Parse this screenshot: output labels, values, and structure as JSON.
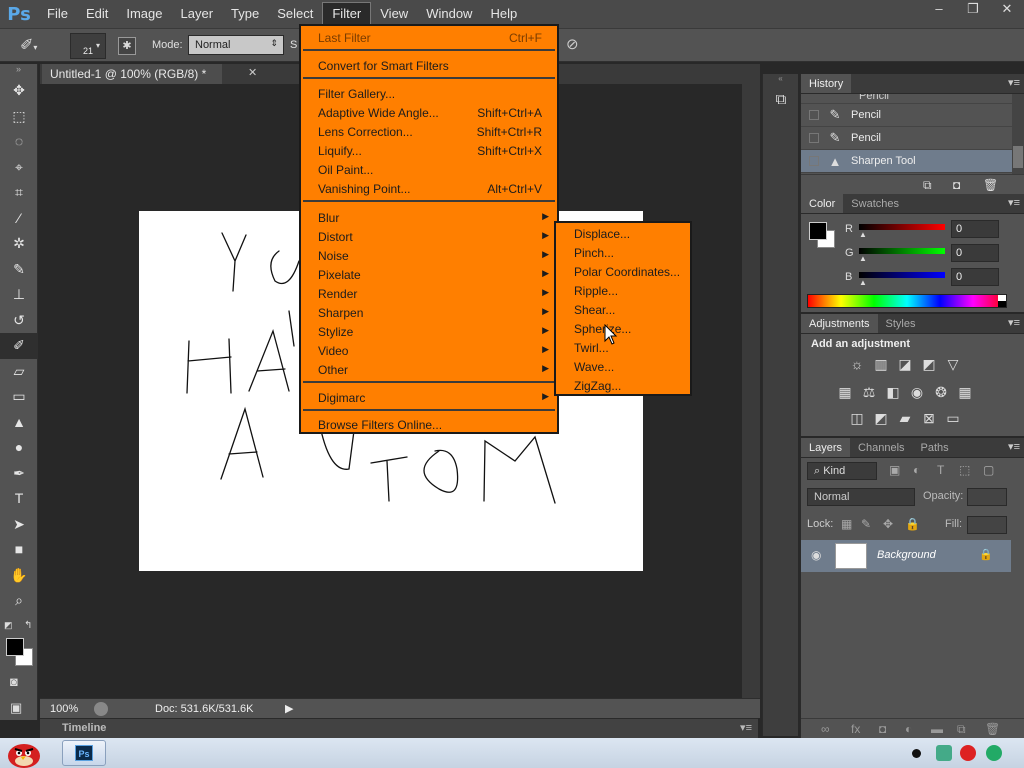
{
  "app": {
    "logo_text": "Ps",
    "menu": [
      "File",
      "Edit",
      "Image",
      "Layer",
      "Type",
      "Select",
      "Filter",
      "View",
      "Window",
      "Help"
    ],
    "active_menu": "Filter",
    "window_controls": [
      "–",
      "❐",
      "✕"
    ]
  },
  "options_bar": {
    "brush_size": "21",
    "mode_label": "Mode:",
    "mode_value": "Normal",
    "strength_label": "S"
  },
  "document": {
    "tab_title": "Untitled-1 @ 100% (RGB/8) *",
    "zoom": "100%",
    "doc_size": "Doc: 531.6K/531.6K",
    "timeline_label": "Timeline"
  },
  "filter_menu": {
    "items": [
      {
        "label": "Last Filter",
        "shortcut": "Ctrl+F",
        "disabled": true
      },
      {
        "label": "Convert for Smart Filters",
        "shortcut": ""
      },
      {
        "label": "Filter Gallery...",
        "shortcut": ""
      },
      {
        "label": "Adaptive Wide Angle...",
        "shortcut": "Shift+Ctrl+A"
      },
      {
        "label": "Lens Correction...",
        "shortcut": "Shift+Ctrl+R"
      },
      {
        "label": "Liquify...",
        "shortcut": "Shift+Ctrl+X"
      },
      {
        "label": "Oil Paint...",
        "shortcut": ""
      },
      {
        "label": "Vanishing Point...",
        "shortcut": "Alt+Ctrl+V"
      },
      {
        "label": "Blur",
        "submenu": true
      },
      {
        "label": "Distort",
        "submenu": true
      },
      {
        "label": "Noise",
        "submenu": true
      },
      {
        "label": "Pixelate",
        "submenu": true
      },
      {
        "label": "Render",
        "submenu": true
      },
      {
        "label": "Sharpen",
        "submenu": true
      },
      {
        "label": "Stylize",
        "submenu": true
      },
      {
        "label": "Video",
        "submenu": true
      },
      {
        "label": "Other",
        "submenu": true
      },
      {
        "label": "Digimarc",
        "submenu": true
      },
      {
        "label": "Browse Filters Online...",
        "shortcut": ""
      }
    ],
    "distort_submenu": [
      "Displace...",
      "Pinch...",
      "Polar Coordinates...",
      "Ripple...",
      "Shear...",
      "Spherize...",
      "Twirl...",
      "Wave...",
      "ZigZag..."
    ]
  },
  "history_panel": {
    "tabs": [
      "History"
    ],
    "partial_item": "Pencil",
    "items": [
      {
        "label": "Pencil",
        "selected": false
      },
      {
        "label": "Pencil",
        "selected": false
      },
      {
        "label": "Sharpen Tool",
        "selected": true
      }
    ]
  },
  "color_panel": {
    "tabs": [
      "Color",
      "Swatches"
    ],
    "channels": [
      {
        "label": "R",
        "value": "0",
        "color": "#ff0000"
      },
      {
        "label": "G",
        "value": "0",
        "color": "#00ff00"
      },
      {
        "label": "B",
        "value": "0",
        "color": "#0000ff"
      }
    ]
  },
  "adjustments_panel": {
    "tabs": [
      "Adjustments",
      "Styles"
    ],
    "title": "Add an adjustment"
  },
  "layers_panel": {
    "tabs": [
      "Layers",
      "Channels",
      "Paths"
    ],
    "kind_label": "Kind",
    "blend_mode": "Normal",
    "opacity_label": "Opacity:",
    "lock_label": "Lock:",
    "fill_label": "Fill:",
    "layer_name": "Background"
  },
  "colors": {
    "menu_bg": "#ff7f00",
    "selected_row": "#6f7c8c"
  }
}
